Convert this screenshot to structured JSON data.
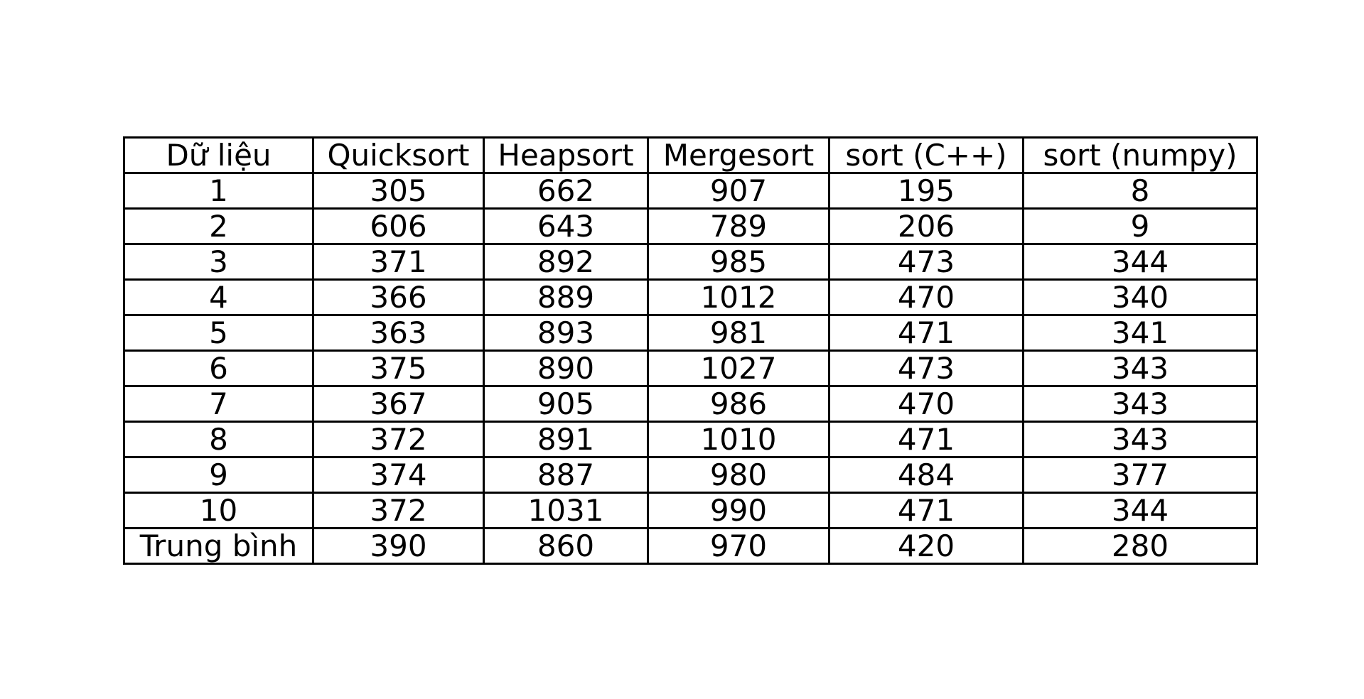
{
  "chart_data": {
    "type": "table",
    "columns": [
      "Dữ liệu",
      "Quicksort",
      "Heapsort",
      "Mergesort",
      "sort (C++)",
      "sort (numpy)"
    ],
    "rows": [
      [
        "1",
        "305",
        "662",
        "907",
        "195",
        "8"
      ],
      [
        "2",
        "606",
        "643",
        "789",
        "206",
        "9"
      ],
      [
        "3",
        "371",
        "892",
        "985",
        "473",
        "344"
      ],
      [
        "4",
        "366",
        "889",
        "1012",
        "470",
        "340"
      ],
      [
        "5",
        "363",
        "893",
        "981",
        "471",
        "341"
      ],
      [
        "6",
        "375",
        "890",
        "1027",
        "473",
        "343"
      ],
      [
        "7",
        "367",
        "905",
        "986",
        "470",
        "343"
      ],
      [
        "8",
        "372",
        "891",
        "1010",
        "471",
        "343"
      ],
      [
        "9",
        "374",
        "887",
        "980",
        "484",
        "377"
      ],
      [
        "10",
        "372",
        "1031",
        "990",
        "471",
        "344"
      ],
      [
        "Trung bình",
        "390",
        "860",
        "970",
        "420",
        "280"
      ]
    ],
    "title": "",
    "grid": true,
    "colors": {
      "border": "#000000",
      "text": "#000000",
      "background": "#ffffff"
    }
  }
}
